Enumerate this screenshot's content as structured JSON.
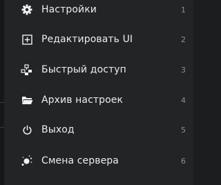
{
  "menu": {
    "items": [
      {
        "label": "Настройки",
        "hotkey": "1",
        "icon": "gear-icon"
      },
      {
        "label": "Редактировать UI",
        "hotkey": "2",
        "icon": "edit-ui-icon"
      },
      {
        "label": "Быстрый доступ",
        "hotkey": "3",
        "icon": "quick-access-icon"
      },
      {
        "label": "Архив настроек",
        "hotkey": "4",
        "icon": "folder-icon"
      },
      {
        "label": "Выход",
        "hotkey": "5",
        "icon": "power-icon"
      },
      {
        "label": "Смена сервера",
        "hotkey": "6",
        "icon": "server-switch-icon"
      }
    ]
  },
  "colors": {
    "background": "#232425",
    "text": "#ededed",
    "hotkey": "#8d8f90"
  }
}
